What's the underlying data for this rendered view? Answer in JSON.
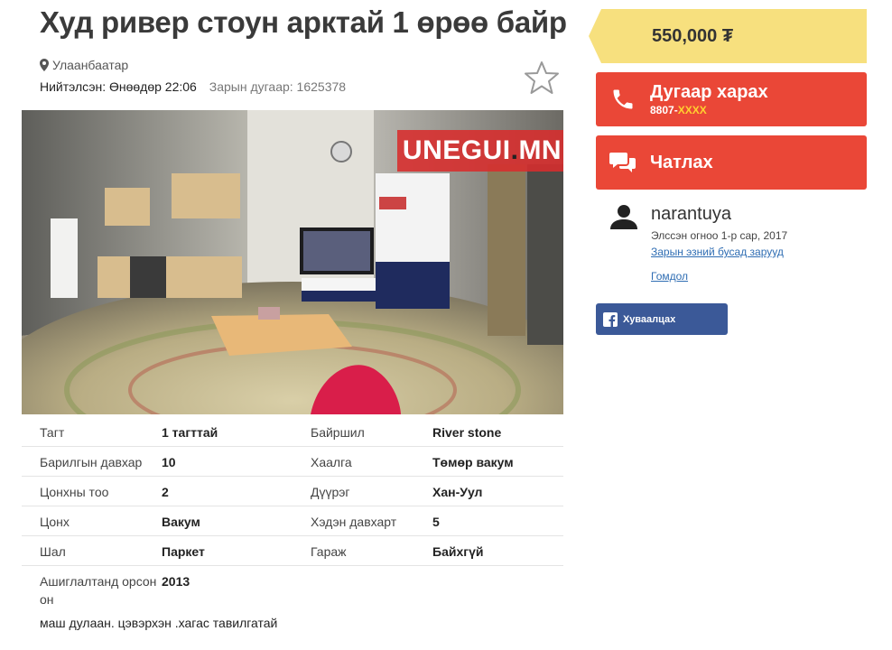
{
  "listing": {
    "title": "Худ ривер стоун арктай 1 өрөө байр",
    "location": "Улаанбаатар",
    "posted": "Нийтэлсэн: Өнөөдөр 22:06",
    "ad_number": "Зарын дугаар: 1625378",
    "watermark_main": "UNEGUI",
    "watermark_dot": ".",
    "watermark_tld": "MN",
    "description": "маш дулаан. цэвэрхэн .хагас тавилгатай"
  },
  "specs_left": [
    {
      "label": "Тагт",
      "value": "1 тагттай"
    },
    {
      "label": "Барилгын давхар",
      "value": "10"
    },
    {
      "label": "Цонхны тоо",
      "value": "2"
    },
    {
      "label": "Цонх",
      "value": "Вакум"
    },
    {
      "label": "Шал",
      "value": "Паркет"
    },
    {
      "label": "Ашиглалтанд орсон он",
      "value": "2013"
    }
  ],
  "specs_right": [
    {
      "label": "Байршил",
      "value": "River stone"
    },
    {
      "label": "Хаалга",
      "value": "Төмөр вакум"
    },
    {
      "label": "Дүүрэг",
      "value": "Хан-Уул"
    },
    {
      "label": "Хэдэн давхарт",
      "value": "5"
    },
    {
      "label": "Гараж",
      "value": "Байхгүй"
    }
  ],
  "sidebar": {
    "price": "550,000 ₮",
    "phone_label": "Дугаар харах",
    "phone_prefix": "8807-",
    "phone_mask": "XXXX",
    "chat_label": "Чатлах",
    "user_name": "narantuya",
    "user_since": "Элссэн огноо 1-р сар, 2017",
    "other_ads_link": "Зарын эзний бусад зарууд",
    "report_link": "Гомдол",
    "share_label": "Хуваалцах"
  },
  "colors": {
    "accent": "#ea4737",
    "price_bg": "#f7e07e",
    "link": "#2f6db3",
    "facebook": "#3b5998"
  },
  "icons": [
    "location-pin-icon",
    "star-outline-icon",
    "phone-icon",
    "chat-icon",
    "user-icon",
    "facebook-icon"
  ]
}
